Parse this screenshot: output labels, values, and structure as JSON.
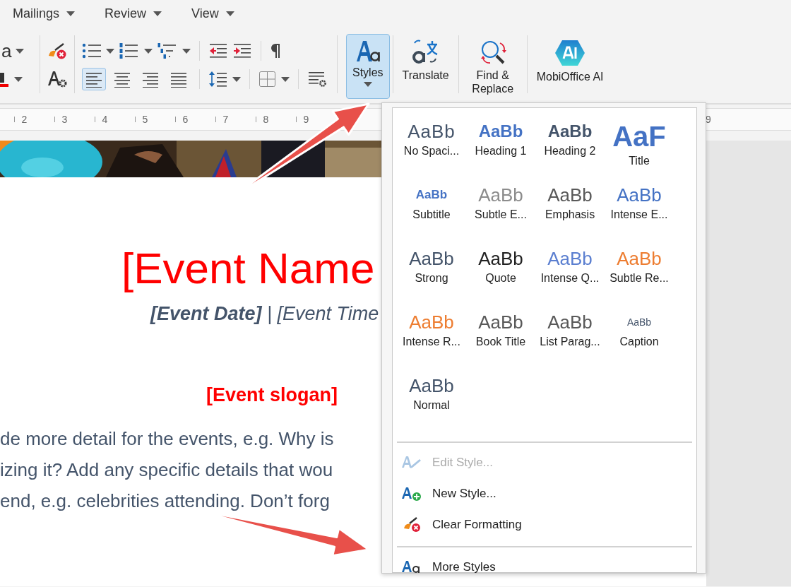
{
  "menu_tabs": [
    {
      "label": "Mailings"
    },
    {
      "label": "Review"
    },
    {
      "label": "View"
    }
  ],
  "ribbon": {
    "font_name_fragment": "a",
    "alignment": [
      {
        "kind": "left",
        "selected": true
      },
      {
        "kind": "center",
        "selected": false
      },
      {
        "kind": "right",
        "selected": false
      },
      {
        "kind": "justify",
        "selected": false
      }
    ],
    "big_buttons": [
      {
        "kind": "styles",
        "label": "Styles",
        "selected": true
      },
      {
        "kind": "translate",
        "label": "Translate",
        "selected": false
      },
      {
        "kind": "find",
        "label": "Find & Replace",
        "selected": false
      },
      {
        "kind": "ai",
        "label": "MobiOffice AI",
        "selected": false
      }
    ]
  },
  "ruler": {
    "numbers": [
      "2",
      "3",
      "4",
      "5",
      "6",
      "7",
      "8",
      "9"
    ],
    "right_number": "9"
  },
  "document": {
    "title": "[Event Name",
    "date_line": "**[Event Date]** | [Event Time",
    "slogan": "[Event slogan]",
    "body_lines": [
      "de more detail for the events, e.g. Why is",
      "izing it? Add any specific details that wou",
      "end, e.g. celebrities attending. Don’t forg"
    ]
  },
  "styles_menu": {
    "items": [
      {
        "label": "No Spaci...",
        "preview": "AaBb",
        "kind": "light"
      },
      {
        "label": "Heading 1",
        "preview": "AaBb",
        "kind": "heading1"
      },
      {
        "label": "Heading 2",
        "preview": "AaBb",
        "kind": "heading2"
      },
      {
        "label": "Title",
        "preview": "AaF",
        "kind": "title"
      },
      {
        "label": "Subtitle",
        "preview": "AaBb",
        "kind": "subtitle"
      },
      {
        "label": "Subtle E...",
        "preview": "AaBb",
        "kind": "subtle"
      },
      {
        "label": "Emphasis",
        "preview": "AaBb",
        "kind": "emphasis"
      },
      {
        "label": "Intense E...",
        "preview": "AaBb",
        "kind": "intense"
      },
      {
        "label": "Strong",
        "preview": "AaBb",
        "kind": "strong"
      },
      {
        "label": "Quote",
        "preview": "AaBb",
        "kind": "quote"
      },
      {
        "label": "Intense Q...",
        "preview": "AaBb",
        "kind": "intense_quote"
      },
      {
        "label": "Subtle Re...",
        "preview": "AaBb",
        "kind": "subtle_ref"
      },
      {
        "label": "Intense R...",
        "preview": "AaBb",
        "kind": "intense_ref"
      },
      {
        "label": "Book Title",
        "preview": "AaBb",
        "kind": "book"
      },
      {
        "label": "List Parag...",
        "preview": "AaBb",
        "kind": "list"
      },
      {
        "label": "Caption",
        "preview": "AaBb",
        "kind": "caption"
      },
      {
        "label": "Normal",
        "preview": "AaBb",
        "kind": "normal"
      }
    ],
    "actions": [
      {
        "kind": "edit",
        "label": "Edit Style...",
        "disabled": true
      },
      {
        "kind": "new",
        "label": "New Style...",
        "disabled": false
      },
      {
        "kind": "clear",
        "label": "Clear Formatting",
        "disabled": false
      }
    ],
    "footer_actions": [
      {
        "kind": "more",
        "label": "More Styles",
        "disabled": false
      }
    ]
  }
}
